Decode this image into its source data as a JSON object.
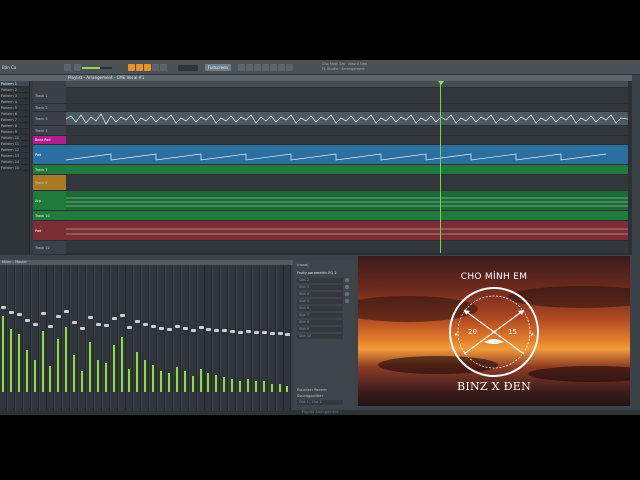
{
  "app": {
    "window_label": "Bản Ca",
    "status_text": "Playlist Arrangement"
  },
  "toolbar": {
    "display_text": "Fullscreen",
    "info_line1": "Cho Minh Em · Binz x Đen",
    "info_line2": "FL Studio · Arrangement"
  },
  "playlist": {
    "title": "Playlist - Arrangement - CME Vocal #1",
    "patterns": [
      "Pattern 1",
      "Pattern 2",
      "Pattern 3",
      "Pattern 4",
      "Pattern 5",
      "Pattern 6",
      "Pattern 7",
      "Pattern 8",
      "Pattern 9",
      "Pattern 10",
      "Pattern 11",
      "Pattern 12",
      "Pattern 13",
      "Pattern 14",
      "Pattern 15"
    ],
    "tracks": [
      {
        "name": "Track 1"
      },
      {
        "name": "Track 2"
      },
      {
        "name": "Track 3"
      },
      {
        "name": "Track 4"
      },
      {
        "name": "Beat Pad"
      },
      {
        "name": "Pad"
      },
      {
        "name": "Track 7"
      },
      {
        "name": "Track 8"
      },
      {
        "name": "Arp"
      },
      {
        "name": "Track 10"
      },
      {
        "name": "Pad"
      },
      {
        "name": "Track 12"
      }
    ],
    "clip_labels": {
      "vocal": "CME Vocal #1",
      "pattern": "Pattern 1",
      "pattern8": "Pattern 8",
      "pattern12": "Pattern 12"
    }
  },
  "mixer": {
    "title": "Mixer - Master",
    "channel_meter_levels": [
      0.72,
      0.6,
      0.55,
      0.4,
      0.3,
      0.58,
      0.25,
      0.5,
      0.62,
      0.35,
      0.2,
      0.48,
      0.3,
      0.28,
      0.45,
      0.52,
      0.22,
      0.38,
      0.3,
      0.26,
      0.2,
      0.18,
      0.24,
      0.2,
      0.15,
      0.22,
      0.18,
      0.16,
      0.14,
      0.12,
      0.1,
      0.12,
      0.1,
      0.1,
      0.08,
      0.08,
      0.06
    ]
  },
  "channel_panel": {
    "name": "(none)",
    "header": "Fruity parametric EQ 2",
    "slots": [
      "Slot 2",
      "Slot 3",
      "Slot 4",
      "Slot 5",
      "Slot 6",
      "Slot 7",
      "Slot 8",
      "Slot 9",
      "Slot 10"
    ],
    "row_a": "Equalizer Reverb",
    "row_b": "Soundgoodizer",
    "bottom": "(none)",
    "out": "Out 1 - Out 2"
  },
  "video": {
    "top_text": "CHO MÌNH EM",
    "year_left": "20",
    "year_right": "15",
    "bottom_text": "BINZ X ĐEN"
  },
  "colors": {
    "accent_green": "#8be03a",
    "toolbar_orange": "#e8902a",
    "track_blue": "#2a6fa0",
    "track_green": "#1f7a3d",
    "track_red": "#7a2e33",
    "track_magenta": "#b21f8c"
  }
}
